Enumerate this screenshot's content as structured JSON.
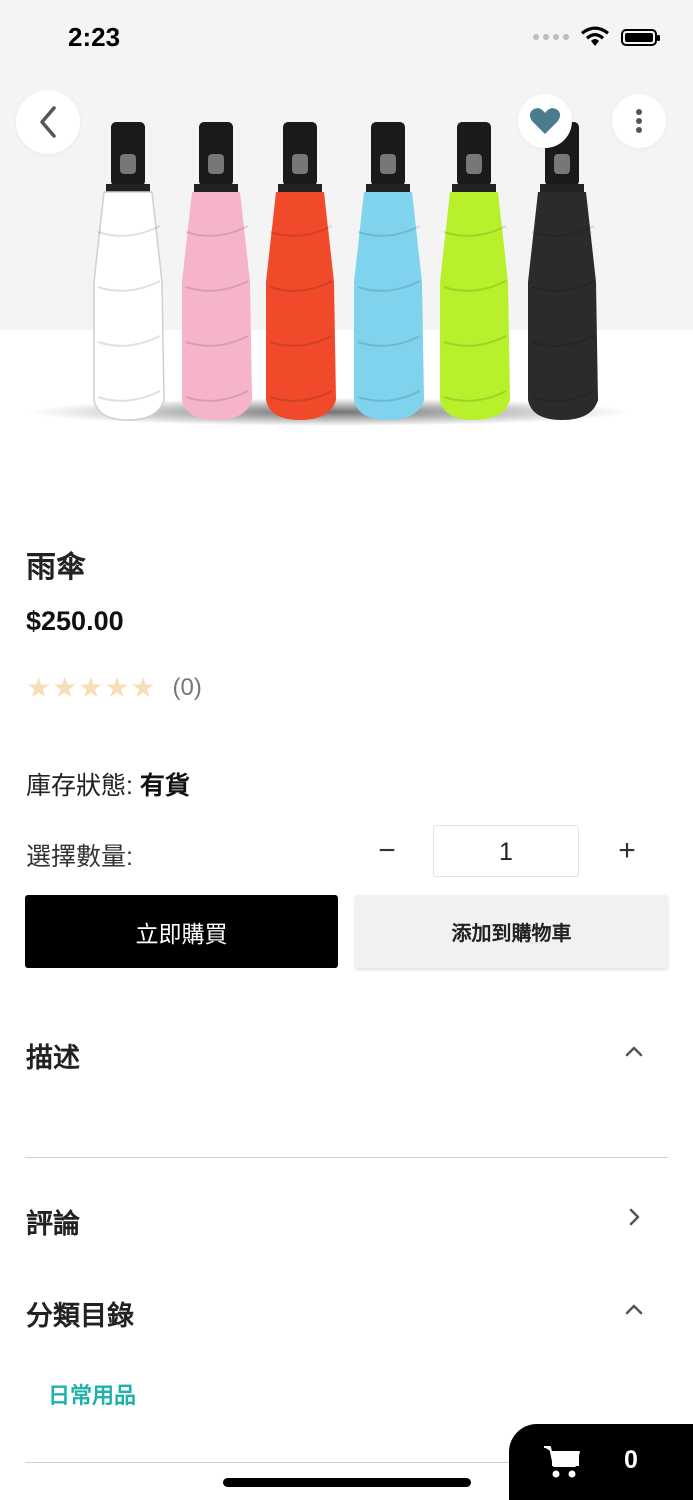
{
  "status_bar": {
    "time": "2:23"
  },
  "product": {
    "title": "雨傘",
    "price": "$250.00",
    "rating_count": "(0)",
    "stock_label": "庫存狀態:",
    "stock_value": "有貨",
    "quantity_label": "選擇數量:",
    "quantity_value": "1",
    "minus_symbol": "−",
    "plus_symbol": "+",
    "rating_stars": 0,
    "image_colors": [
      "#ffffff",
      "#f6b4c8",
      "#f04a2a",
      "#7fd3ec",
      "#b8f02c",
      "#2b2b2b"
    ]
  },
  "actions": {
    "buy_now": "立即購買",
    "add_to_cart": "添加到購物車"
  },
  "sections": {
    "description": "描述",
    "reviews": "評論",
    "categories": "分類目錄",
    "category_item": "日常用品"
  },
  "cart": {
    "count": "0"
  },
  "colors": {
    "accent_teal": "#20b2aa",
    "star_empty": "#f5dfb8",
    "primary_button": "#000000"
  }
}
